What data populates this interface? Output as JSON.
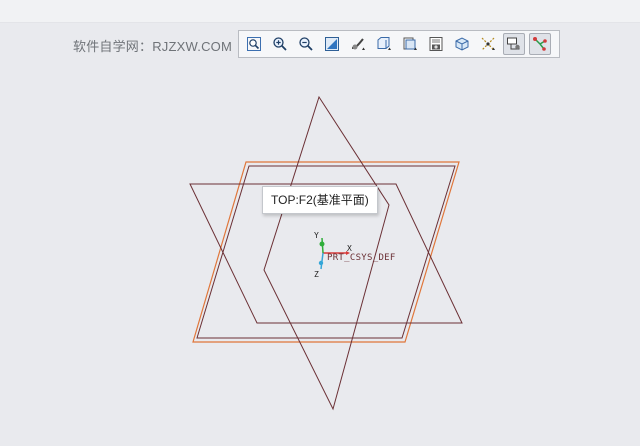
{
  "watermark": {
    "text": "软件自学网：RJZXW.COM"
  },
  "toolbar": {
    "buttons": [
      {
        "name": "refit-zoom-icon",
        "active": false
      },
      {
        "name": "zoom-in-icon",
        "active": false
      },
      {
        "name": "zoom-out-icon",
        "active": false
      },
      {
        "name": "repaint-icon",
        "active": false
      },
      {
        "name": "reorient-icon",
        "active": false
      },
      {
        "name": "saved-orientations-icon",
        "active": false
      },
      {
        "name": "display-style-icon",
        "active": false
      },
      {
        "name": "view-manager-icon",
        "active": false
      },
      {
        "name": "perspective-icon",
        "active": false
      },
      {
        "name": "datum-display-icon",
        "active": false
      },
      {
        "name": "annotation-display-icon",
        "active": true
      },
      {
        "name": "spin-center-icon",
        "active": true
      }
    ]
  },
  "viewport": {
    "tooltip": "TOP:F2(基准平面)",
    "csys_label": "PRT_CSYS_DEF",
    "axis_x": "X",
    "axis_y": "Y",
    "axis_z": "Z",
    "colors": {
      "background": "#e9eaee",
      "datum_plane": "#6b3035",
      "highlight_plane": "#e0763a",
      "axis_x": "#d83a3a",
      "axis_y": "#2fae3a",
      "axis_z": "#34a6d8"
    }
  }
}
